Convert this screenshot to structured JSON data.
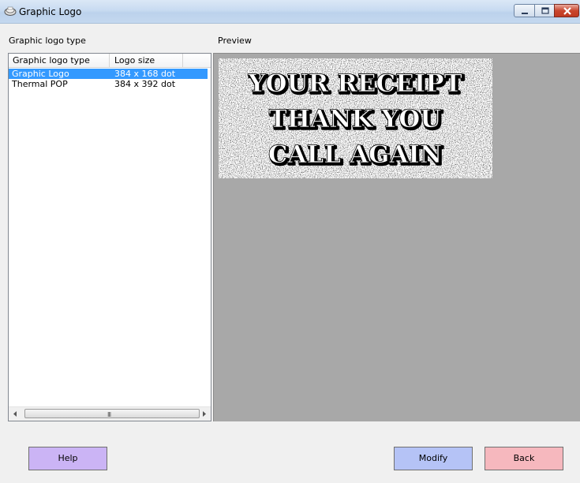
{
  "window": {
    "title": "Graphic Logo"
  },
  "left_panel": {
    "label": "Graphic logo type",
    "columns": [
      "Graphic logo type",
      "Logo size"
    ],
    "rows": [
      {
        "type": "Graphic Logo",
        "size": "384 x 168 dot",
        "selected": true
      },
      {
        "type": "Thermal POP",
        "size": "384 x 392 dot",
        "selected": false
      }
    ],
    "scrollbar_grip": "III"
  },
  "preview": {
    "label": "Preview",
    "logo_lines": [
      "YOUR RECEIPT",
      "THANK YOU",
      "CALL AGAIN"
    ]
  },
  "buttons": {
    "help": "Help",
    "modify": "Modify",
    "back": "Back"
  },
  "colors": {
    "selection": "#3399ff",
    "preview_bg": "#a8a8a8",
    "help_button": "#cbb4f5",
    "modify_button": "#b5c3f6",
    "back_button": "#f6b8be"
  }
}
